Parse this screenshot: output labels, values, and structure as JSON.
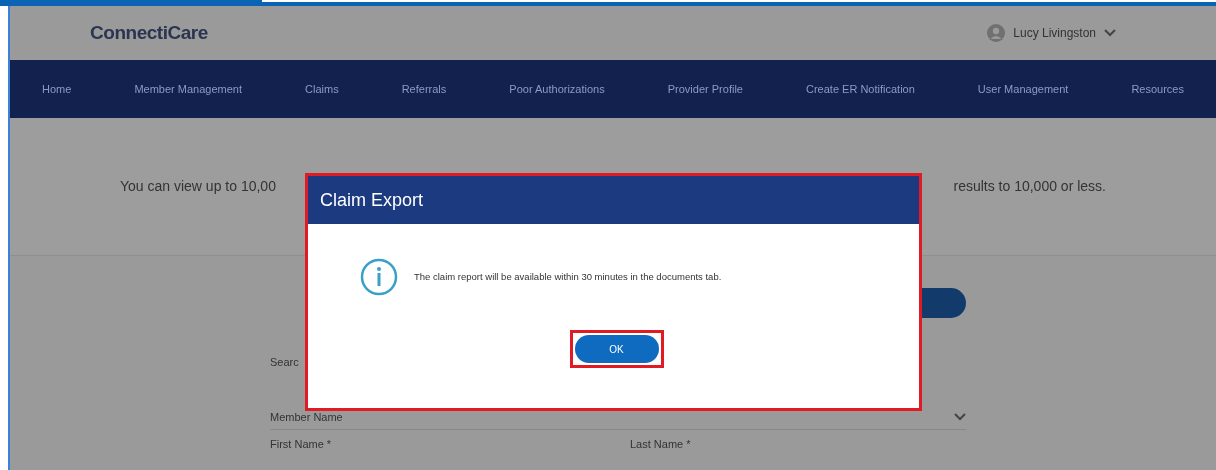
{
  "header": {
    "logo": "ConnectiCare",
    "user": "Lucy Livingston"
  },
  "nav": [
    {
      "label": "Home"
    },
    {
      "label": "Member Management"
    },
    {
      "label": "Claims"
    },
    {
      "label": "Referrals"
    },
    {
      "label": "Poor Authorizations"
    },
    {
      "label": "Provider Profile"
    },
    {
      "label": "Create ER Notification"
    },
    {
      "label": "User Management"
    },
    {
      "label": "Resources"
    }
  ],
  "notice": {
    "left": "You can view up to 10,00",
    "right": "results to 10,000 or less."
  },
  "form": {
    "search_label": "Searc",
    "member_field": "Member Name",
    "first_name": "First Name *",
    "last_name": "Last Name *"
  },
  "dialog": {
    "title": "Claim Export",
    "message": "The claim report will be available within 30 minutes in the documents tab.",
    "button": "OK"
  }
}
